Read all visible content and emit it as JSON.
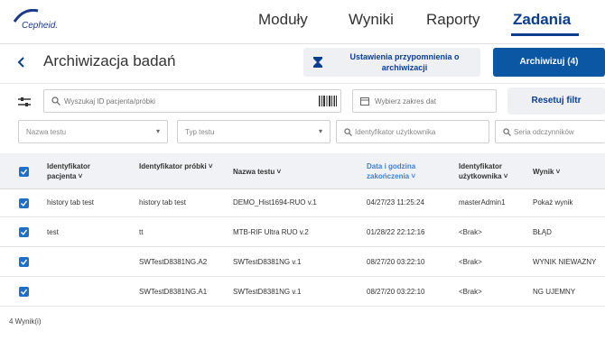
{
  "brand": {
    "logo_text": "Cepheid."
  },
  "nav": {
    "items": [
      {
        "label": "Moduły",
        "active": false
      },
      {
        "label": "Wyniki",
        "active": false
      },
      {
        "label": "Raporty",
        "active": false
      },
      {
        "label": "Zadania",
        "active": true
      }
    ]
  },
  "header": {
    "title": "Archiwizacja badań",
    "remind_label": "Ustawienia przypomnienia o archiwizacji",
    "archive_label": "Archiwizuj (4)"
  },
  "filters": {
    "search_placeholder": "Wyszukaj ID pacjenta/próbki",
    "date_placeholder": "Wybierz zakres dat",
    "reset_label": "Resetuj filtr",
    "test_name_select": "Nazwa testu",
    "test_type_select": "Typ testu",
    "user_id_placeholder": "Identyfikator użytkownika",
    "serial_placeholder": "Seria odczynników"
  },
  "table": {
    "columns": [
      {
        "label": "Identyfikator pacjenta ˅"
      },
      {
        "label": "Identyfikator próbki ˅"
      },
      {
        "label": "Nazwa testu ˅"
      },
      {
        "label": "Data i godzina zakończenia ˅"
      },
      {
        "label": "Identyfikator użytkownika ˅"
      },
      {
        "label": "Wynik ˅"
      }
    ],
    "rows": [
      {
        "patient": "history tab test",
        "sample": "history tab test",
        "test": "DEMO_Hist1694-RUO v.1",
        "date": "04/27/23 11:25:24",
        "user": "masterAdmin1",
        "result": "Pokaż wynik"
      },
      {
        "patient": "test",
        "sample": "tt",
        "test": "MTB-RIF Ultra RUO v.2",
        "date": "01/28/22 22:12:16",
        "user": "<Brak>",
        "result": "BŁĄD"
      },
      {
        "patient": "",
        "sample": "SWTestD8381NG.A2",
        "test": "SWTestD8381NG v.1",
        "date": "08/27/20 03:22:10",
        "user": "<Brak>",
        "result": "WYNIK NIEWAŻNY"
      },
      {
        "patient": "",
        "sample": "SWTestD8381NG.A1",
        "test": "SWTestD8381NG v.1",
        "date": "08/27/20 03:22:10",
        "user": "<Brak>",
        "result": "NG UJEMNY"
      }
    ]
  },
  "footer": {
    "count": "4 Wynik(i)"
  },
  "colors": {
    "primary": "#0b57a4",
    "accent": "#3b82d6",
    "checkbox": "#1e6fc8"
  }
}
